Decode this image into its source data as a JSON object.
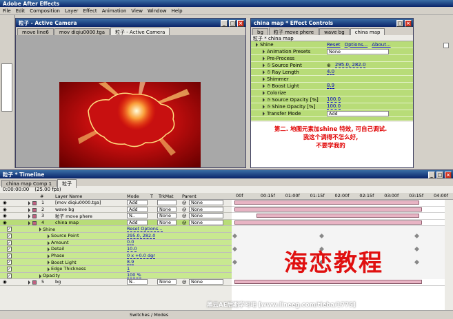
{
  "app_title": "Adobe After Effects",
  "menu": [
    "File",
    "Edit",
    "Composition",
    "Layer",
    "Effect",
    "Animation",
    "View",
    "Window",
    "Help"
  ],
  "composition_window": {
    "title": "粒子 - Active Camera",
    "tabs": [
      "move line6",
      "mov diqiu0000.tga",
      "粒子 - Active Camera"
    ]
  },
  "effect_controls": {
    "title": "china map * Effect Controls",
    "tabs": [
      "bg",
      "粒子 move phere",
      "wave bg",
      "china map"
    ],
    "breadcrumb": "粒子 * china map",
    "rows": [
      {
        "label": "Shine",
        "kind": "effect",
        "extra": "Reset",
        "extra2": "Options...",
        "extra3": "About..."
      },
      {
        "label": "Animation Presets",
        "kind": "dd",
        "value": "None"
      },
      {
        "label": "Pre-Process",
        "kind": "group"
      },
      {
        "label": "Source Point",
        "kind": "prop",
        "value": "295.0, 282.0"
      },
      {
        "label": "Ray Length",
        "kind": "prop",
        "value": "4.0"
      },
      {
        "label": "Shimmer",
        "kind": "group"
      },
      {
        "label": "Boost Light",
        "kind": "prop",
        "value": "8.9"
      },
      {
        "label": "Colorize",
        "kind": "group"
      },
      {
        "label": "Source Opacity [%]",
        "kind": "prop",
        "value": "100.0"
      },
      {
        "label": "Shine Opacity [%]",
        "kind": "prop",
        "value": "100.0"
      },
      {
        "label": "Transfer Mode",
        "kind": "dd",
        "value": "Add"
      }
    ]
  },
  "annotation_lines": [
    "第二. 地图元素加shine 特效, 可自己调试.",
    "我这个调得不怎么好,",
    "不要学我的"
  ],
  "timeline": {
    "title": "粒子 * Timeline",
    "tabs": [
      "china map Comp 1",
      "粒子"
    ],
    "timecode": "0:00:00:00",
    "fps": "(25.00 fps)",
    "columns": [
      "#",
      "Layer Name",
      "Mode",
      "T",
      "TrkMat",
      "Parent"
    ],
    "ruler": [
      "00f",
      "00:15f",
      "01:00f",
      "01:15f",
      "02:00f",
      "02:15f",
      "03:00f",
      "03:15f",
      "04:00f"
    ],
    "layers": [
      {
        "num": "1",
        "name": "[mov diqiu0000.tga]",
        "mode": "Add",
        "trk": "",
        "parent": "None",
        "color": "#c06080"
      },
      {
        "num": "2",
        "name": "wave bg",
        "mode": "Add",
        "trk": "None",
        "parent": "None",
        "color": "#c06080"
      },
      {
        "num": "3",
        "name": "粒子 move phere",
        "mode": "N..",
        "trk": "None",
        "parent": "None",
        "color": "#c06080"
      },
      {
        "num": "4",
        "name": "china map",
        "mode": "Add",
        "trk": "None",
        "parent": "None",
        "color": "#c06080"
      }
    ],
    "sub_rows": [
      {
        "label": "Shine",
        "value": "Reset Options..."
      },
      {
        "label": "Source Point",
        "value": "295.0, 282.0"
      },
      {
        "label": "Amount",
        "value": "0.0"
      },
      {
        "label": "Detail",
        "value": "10.0"
      },
      {
        "label": "Phase",
        "value": "0 x +0.0 dgr"
      },
      {
        "label": "Boost Light",
        "value": "8.9"
      },
      {
        "label": "Edge Thickness",
        "value": "1"
      },
      {
        "label": "Opacity",
        "value": "100 %"
      }
    ],
    "layer5": {
      "num": "5",
      "name": "bg",
      "mode": "N..",
      "trk": "None",
      "parent": "None"
    },
    "footer": "Switches / Modes"
  },
  "overlay_title": "海恋教程",
  "watermark": "黑云AE后期学习吧 [www.lineeg.com/tieba/1775]"
}
